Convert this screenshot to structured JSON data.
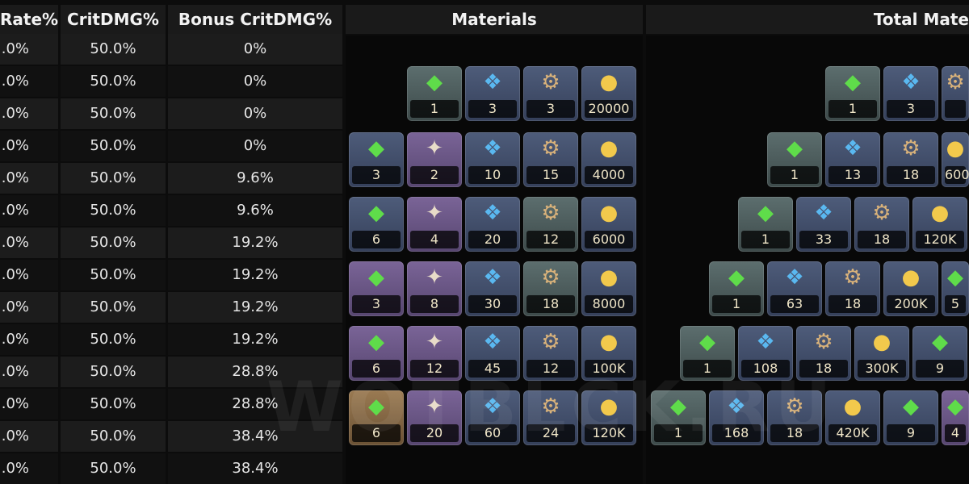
{
  "headers": {
    "rate": "Rate%",
    "crit_dmg": "CritDMG%",
    "bonus_crit": "Bonus CritDMG%",
    "materials": "Materials",
    "total_materials": "Total Mate"
  },
  "rows": [
    {
      "rate": ".0%",
      "crit": "50.0%",
      "bonus": "0%"
    },
    {
      "rate": ".0%",
      "crit": "50.0%",
      "bonus": "0%"
    },
    {
      "rate": ".0%",
      "crit": "50.0%",
      "bonus": "0%"
    },
    {
      "rate": ".0%",
      "crit": "50.0%",
      "bonus": "0%"
    },
    {
      "rate": ".0%",
      "crit": "50.0%",
      "bonus": "9.6%"
    },
    {
      "rate": ".0%",
      "crit": "50.0%",
      "bonus": "9.6%"
    },
    {
      "rate": ".0%",
      "crit": "50.0%",
      "bonus": "19.2%"
    },
    {
      "rate": ".0%",
      "crit": "50.0%",
      "bonus": "19.2%"
    },
    {
      "rate": ".0%",
      "crit": "50.0%",
      "bonus": "19.2%"
    },
    {
      "rate": ".0%",
      "crit": "50.0%",
      "bonus": "19.2%"
    },
    {
      "rate": ".0%",
      "crit": "50.0%",
      "bonus": "28.8%"
    },
    {
      "rate": ".0%",
      "crit": "50.0%",
      "bonus": "28.8%"
    },
    {
      "rate": ".0%",
      "crit": "50.0%",
      "bonus": "38.4%"
    },
    {
      "rate": ".0%",
      "crit": "50.0%",
      "bonus": "38.4%"
    }
  ],
  "materials": [
    [
      {
        "type": "green-shard",
        "rarity": "green",
        "qty": "1"
      },
      {
        "type": "blue-crystal",
        "rarity": "blue",
        "qty": "3"
      },
      {
        "type": "gear",
        "rarity": "blue",
        "qty": "3"
      },
      {
        "type": "coin",
        "rarity": "blue",
        "qty": "20000"
      }
    ],
    [
      {
        "type": "green-shard",
        "rarity": "blue",
        "qty": "3"
      },
      {
        "type": "cross-crystal",
        "rarity": "purple",
        "qty": "2"
      },
      {
        "type": "blue-crystal",
        "rarity": "blue",
        "qty": "10"
      },
      {
        "type": "gear",
        "rarity": "blue",
        "qty": "15"
      },
      {
        "type": "coin",
        "rarity": "blue",
        "qty": "4000"
      }
    ],
    [
      {
        "type": "green-shard",
        "rarity": "blue",
        "qty": "6"
      },
      {
        "type": "cross-crystal",
        "rarity": "purple",
        "qty": "4"
      },
      {
        "type": "blue-crystal",
        "rarity": "blue",
        "qty": "20"
      },
      {
        "type": "gear",
        "rarity": "green",
        "qty": "12"
      },
      {
        "type": "coin",
        "rarity": "blue",
        "qty": "6000"
      }
    ],
    [
      {
        "type": "green-shard",
        "rarity": "purple",
        "qty": "3"
      },
      {
        "type": "cross-crystal",
        "rarity": "purple",
        "qty": "8"
      },
      {
        "type": "blue-crystal",
        "rarity": "blue",
        "qty": "30"
      },
      {
        "type": "gear",
        "rarity": "green",
        "qty": "18"
      },
      {
        "type": "coin",
        "rarity": "blue",
        "qty": "8000"
      }
    ],
    [
      {
        "type": "green-shard",
        "rarity": "purple",
        "qty": "6"
      },
      {
        "type": "cross-crystal",
        "rarity": "purple",
        "qty": "12"
      },
      {
        "type": "blue-crystal",
        "rarity": "blue",
        "qty": "45"
      },
      {
        "type": "gear",
        "rarity": "blue",
        "qty": "12"
      },
      {
        "type": "coin",
        "rarity": "blue",
        "qty": "100K"
      }
    ],
    [
      {
        "type": "green-shard",
        "rarity": "gold",
        "qty": "6"
      },
      {
        "type": "cross-crystal",
        "rarity": "purple",
        "qty": "20"
      },
      {
        "type": "blue-crystal",
        "rarity": "blue",
        "qty": "60"
      },
      {
        "type": "gear",
        "rarity": "blue",
        "qty": "24"
      },
      {
        "type": "coin",
        "rarity": "blue",
        "qty": "120K"
      }
    ]
  ],
  "total_materials": [
    [
      {
        "type": "green-shard",
        "rarity": "green",
        "qty": "1"
      },
      {
        "type": "blue-crystal",
        "rarity": "blue",
        "qty": "3"
      },
      {
        "type": "gear",
        "rarity": "blue",
        "qty": ""
      }
    ],
    [
      {
        "type": "green-shard",
        "rarity": "green",
        "qty": "1"
      },
      {
        "type": "blue-crystal",
        "rarity": "blue",
        "qty": "13"
      },
      {
        "type": "gear",
        "rarity": "blue",
        "qty": "18"
      },
      {
        "type": "coin",
        "rarity": "blue",
        "qty": "600"
      }
    ],
    [
      {
        "type": "green-shard",
        "rarity": "green",
        "qty": "1"
      },
      {
        "type": "blue-crystal",
        "rarity": "blue",
        "qty": "33"
      },
      {
        "type": "gear",
        "rarity": "blue",
        "qty": "18"
      },
      {
        "type": "coin",
        "rarity": "blue",
        "qty": "120K"
      }
    ],
    [
      {
        "type": "green-shard",
        "rarity": "green",
        "qty": "1"
      },
      {
        "type": "blue-crystal",
        "rarity": "blue",
        "qty": "63"
      },
      {
        "type": "gear",
        "rarity": "blue",
        "qty": "18"
      },
      {
        "type": "coin",
        "rarity": "blue",
        "qty": "200K"
      },
      {
        "type": "green-shard",
        "rarity": "blue",
        "qty": "5"
      }
    ],
    [
      {
        "type": "green-shard",
        "rarity": "green",
        "qty": "1"
      },
      {
        "type": "blue-crystal",
        "rarity": "blue",
        "qty": "108"
      },
      {
        "type": "gear",
        "rarity": "blue",
        "qty": "18"
      },
      {
        "type": "coin",
        "rarity": "blue",
        "qty": "300K"
      },
      {
        "type": "green-shard",
        "rarity": "blue",
        "qty": "9"
      }
    ],
    [
      {
        "type": "green-shard",
        "rarity": "green",
        "qty": "1"
      },
      {
        "type": "blue-crystal",
        "rarity": "blue",
        "qty": "168"
      },
      {
        "type": "gear",
        "rarity": "blue",
        "qty": "18"
      },
      {
        "type": "coin",
        "rarity": "blue",
        "qty": "420K"
      },
      {
        "type": "green-shard",
        "rarity": "blue",
        "qty": "9"
      },
      {
        "type": "green-shard",
        "rarity": "purple",
        "qty": "4"
      }
    ]
  ],
  "watermark": "WOTBLCK.RU",
  "colors": {
    "background": "#0c0c0c",
    "header_bg": "#1a1a1a",
    "row_even": "#1c1c1c",
    "row_odd": "#111111",
    "qty_text": "#f0e6c8"
  }
}
